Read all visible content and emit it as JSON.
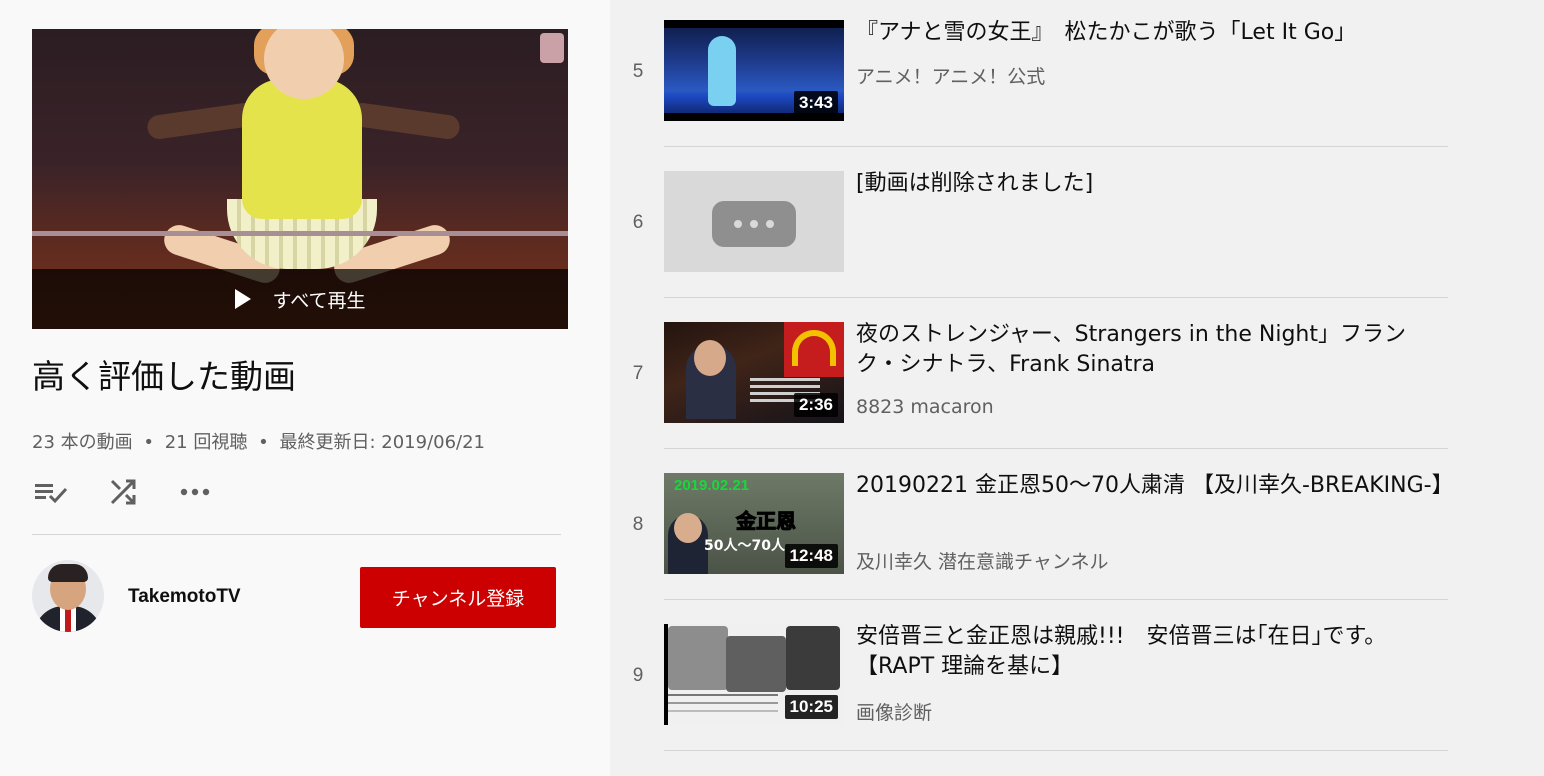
{
  "playlist": {
    "play_all_label": "すべて再生",
    "title": "高く評価した動画",
    "video_count": "23 本の動画",
    "views": "21 回視聴",
    "updated": "最終更新日: 2019/06/21",
    "separator": "•",
    "actions": [
      "save-to-playlist-icon",
      "shuffle-icon",
      "more-icon"
    ]
  },
  "owner": {
    "name": "TakemotoTV",
    "subscribe_label": "チャンネル登録"
  },
  "videos": [
    {
      "index": "5",
      "title": "『アナと雪の女王』　松たかこが歌う「Let It Go」",
      "channel": "アニメ！アニメ！公式",
      "duration": "3:43"
    },
    {
      "index": "6",
      "title": "[動画は削除されました]",
      "channel": "",
      "duration": ""
    },
    {
      "index": "7",
      "title": "夜のストレンジャー、Strangers in the Night」フランク・シナトラ、Frank Sinatra",
      "channel": "8823 macaron",
      "duration": "2:36"
    },
    {
      "index": "8",
      "title": "20190221 金正恩50〜70人粛清 【及川幸久-BREAKING-】",
      "channel": "及川幸久 潜在意識チャンネル",
      "duration": "12:48",
      "thumb_text": {
        "date": "2019.02.21",
        "name": "金正恩",
        "count": "50人〜70人"
      }
    },
    {
      "index": "9",
      "title": "安倍晋三と金正恩は親戚!!!　安倍晋三は｢在日｣です。【RAPT 理論を基に】",
      "channel": "画像診断",
      "duration": "10:25"
    }
  ],
  "colors": {
    "subscribe": "#cc0000",
    "left_bg": "#f9f9f9",
    "right_bg": "#f1f1f1",
    "secondary_text": "#606060"
  }
}
